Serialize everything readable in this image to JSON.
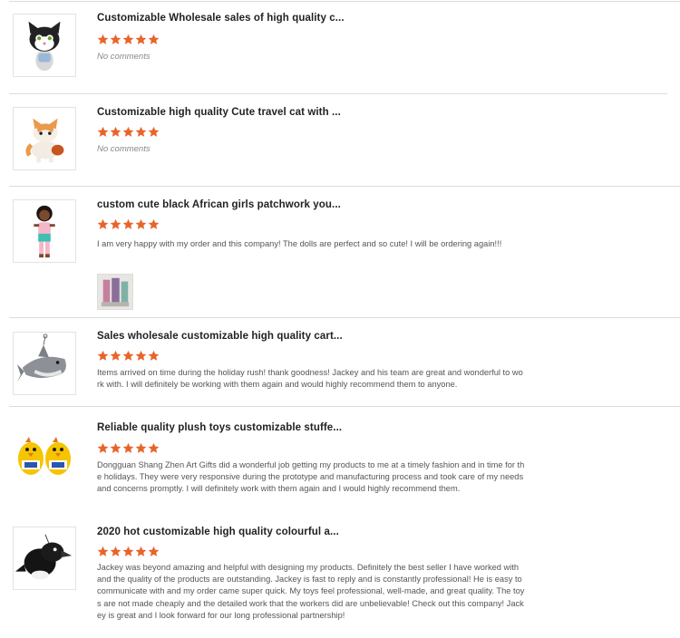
{
  "colors": {
    "star": "#e8652a",
    "separator": "#dcdcdc",
    "title": "#222222",
    "comment": "#555555",
    "no_comment": "#888888"
  },
  "reviews": [
    {
      "title": "Customizable Wholesale sales of high quality c...",
      "rating": 5,
      "comment": "No comments",
      "thumbnail_icon": "black-white-cat-plush-icon"
    },
    {
      "title": "Customizable high quality Cute travel cat with ...",
      "rating": 5,
      "comment": "No comments",
      "thumbnail_icon": "orange-travel-cat-plush-icon"
    },
    {
      "title": "custom cute black African girls patchwork you...",
      "rating": 5,
      "comment": "I am very happy with my order and this company! The dolls are perfect and so cute! I will be ordering again!!!",
      "thumbnail_icon": "african-girl-doll-icon",
      "attachment_icon": "review-photo-icon"
    },
    {
      "title": "Sales wholesale customizable high quality cart...",
      "rating": 5,
      "comment": "Items arrived on time during the holiday rush! thank goodness! Jackey and his team are great and wonderful to work with.  I will definitely be working with them again and would highly recommend them to anyone.",
      "thumbnail_icon": "grey-shark-plush-icon"
    },
    {
      "title": "Reliable quality plush toys customizable stuffe...",
      "rating": 5,
      "comment": "Dongguan Shang Zhen Art Gifts did a wonderful job getting my products to me at a timely fashion and in time for the holidays. They were very responsive during the prototype and manufacturing process and took care of my needs and concerns promptly.  I will definitely work with them again and I would highly recommend them.",
      "thumbnail_icon": "yellow-chick-plush-pair-icon"
    },
    {
      "title": "2020 hot customizable high quality colourful a...",
      "rating": 5,
      "comment": "Jackey was beyond amazing and helpful with designing my products. Definitely the best seller I have worked with and the quality of the products are outstanding. Jackey is fast to reply and is constantly professional! He is easy to communicate with and my order came super quick. My toys feel professional, well-made, and great quality. The toys are not made cheaply and the detailed work that the workers did are unbelievable! Check out this company! Jackey is great and I look forward for our long professional partnership!",
      "thumbnail_icon": "black-bird-plush-icon"
    }
  ]
}
